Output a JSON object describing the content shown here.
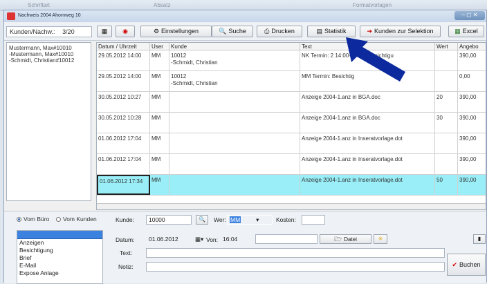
{
  "ribbon": {
    "left": "Schriftart",
    "mid": "Absatz",
    "right": "Formatvorlagen"
  },
  "window": {
    "title": "Nachweis 2004 Ahornweg 10",
    "controls": "– ▢ ✕"
  },
  "toolbar": {
    "count_label": "Kunden/Nachw.:",
    "count_value": "3/20",
    "settings": "Einstellungen",
    "search": "Suche",
    "print": "Drucken",
    "stats": "Statistik",
    "customers_selection": "Kunden zur Selektion",
    "excel": "Excel"
  },
  "customers": [
    "Mustermann, Max#10010",
    "-Mustermann, Max#10010",
    "-Schmidt, Christian#10012"
  ],
  "table": {
    "headers": [
      "Datum / Uhrzeit",
      "User",
      "Kunde",
      "Text",
      "Wert",
      "Angebo"
    ],
    "rows": [
      {
        "date": "29.05.2012 14:00",
        "user": "MM",
        "customer": "10012",
        "customer2": "-Schmidt, Christian",
        "text": "NK Termin:          2 14:00-15:00) Besichtigu",
        "value": "",
        "offer": "390,00"
      },
      {
        "date": "29.05.2012 14:00",
        "user": "MM",
        "customer": "10012",
        "customer2": "-Schmidt, Christian",
        "text": "MM Termin: Besichtig",
        "value": "",
        "offer": "0,00"
      },
      {
        "date": "30.05.2012 10:27",
        "user": "MM",
        "customer": "",
        "customer2": "",
        "text": "Anzeige 2004-1.anz  in BGA.doc",
        "value": "20",
        "offer": "390,00"
      },
      {
        "date": "30.05.2012 10:28",
        "user": "MM",
        "customer": "",
        "customer2": "",
        "text": "Anzeige 2004-1.anz  in BGA.doc",
        "value": "30",
        "offer": "390,00"
      },
      {
        "date": "01.06.2012 17:04",
        "user": "MM",
        "customer": "",
        "customer2": "",
        "text": "Anzeige 2004-1.anz  in Inseratvorlage.dot",
        "value": "",
        "offer": "390,00"
      },
      {
        "date": "01.06.2012 17:04",
        "user": "MM",
        "customer": "",
        "customer2": "",
        "text": "Anzeige 2004-1.anz  in Inseratvorlage.dot",
        "value": "",
        "offer": "390,00"
      },
      {
        "date": "01.06.2012 17:34",
        "user": "MM",
        "customer": "",
        "customer2": "",
        "text": "Anzeige 2004-1.anz  in Inseratvorlage.dot",
        "value": "50",
        "offer": "390,00"
      }
    ]
  },
  "form": {
    "from_office": "Vom Büro",
    "from_customer": "Vom Kunden",
    "customer_label": "Kunde:",
    "customer_value": "10000",
    "who_label": "Wer:",
    "who_value": "MM",
    "cost_label": "Kosten:",
    "date_label": "Datum:",
    "date_value": "01.06.2012",
    "from_label": "Von:",
    "from_value": "16:04",
    "file_button": "Datei",
    "text_label": "Text:",
    "note_label": "Notiz:",
    "book_button": "Buchen",
    "types": [
      "",
      "Anzeigen",
      "Besichtigung",
      "Brief",
      "E-Mail",
      "Expose Anlage"
    ]
  },
  "colors": {
    "selected_row": "#99eef7",
    "arrow": "#0c2a9e",
    "list_highlight": "#3b82e0"
  }
}
